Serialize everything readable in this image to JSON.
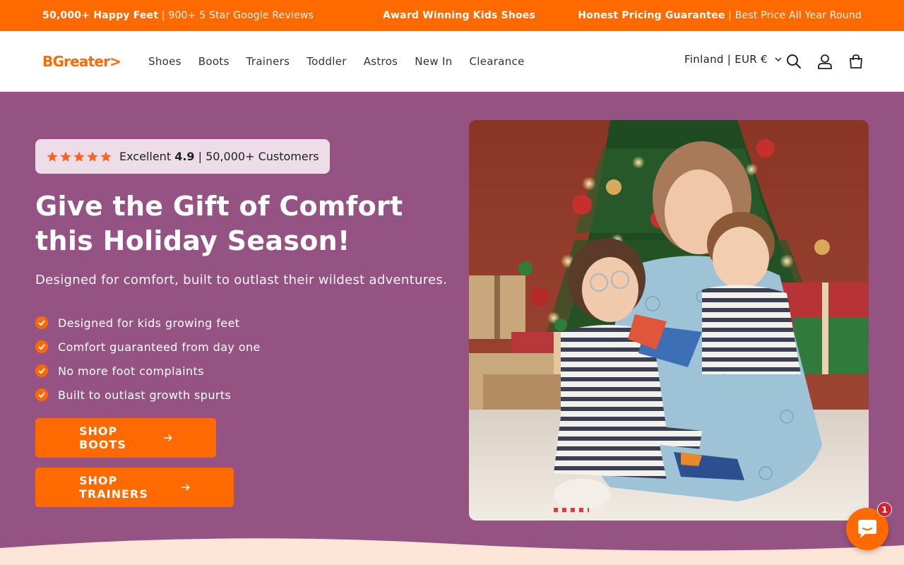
{
  "announcement": {
    "item1_bold": "50,000+ Happy Feet",
    "item1_sep": " | ",
    "item1_rest": "900+ 5 Star Google Reviews",
    "item2_bold": "Award Winning Kids Shoes",
    "item3_bold": "Honest Pricing Guarantee",
    "item3_sep": " | ",
    "item3_rest": "Best Price All Year Round"
  },
  "header": {
    "logo": "BGreater>",
    "nav": [
      "Shoes",
      "Boots",
      "Trainers",
      "Toddler",
      "Astros",
      "New In",
      "Clearance"
    ],
    "locale": "Finland | EUR €",
    "icons": [
      "search-icon",
      "account-icon",
      "cart-icon"
    ]
  },
  "hero": {
    "rating_label": "Excellent",
    "rating_score": "4.9",
    "rating_sep": "|",
    "rating_customers": "50,000+ Customers",
    "stars": 5,
    "headline": "Give the Gift of Comfort this Holiday Season!",
    "subheadline": "Designed for comfort, built to outlast their wildest adventures.",
    "bullets": [
      "Designed for kids growing feet",
      "Comfort guaranteed from day one",
      "No more foot complaints",
      "Built to outlast growth spurts"
    ],
    "button1": "SHOP BOOTS",
    "button2": "SHOP TRAINERS"
  },
  "chat": {
    "badge": "1"
  },
  "colors": {
    "accent": "#ff6a00",
    "hero_bg": "#955384",
    "rating_bg": "#ecdde8",
    "wave": "#fde6d8",
    "badge": "#d6232d"
  }
}
